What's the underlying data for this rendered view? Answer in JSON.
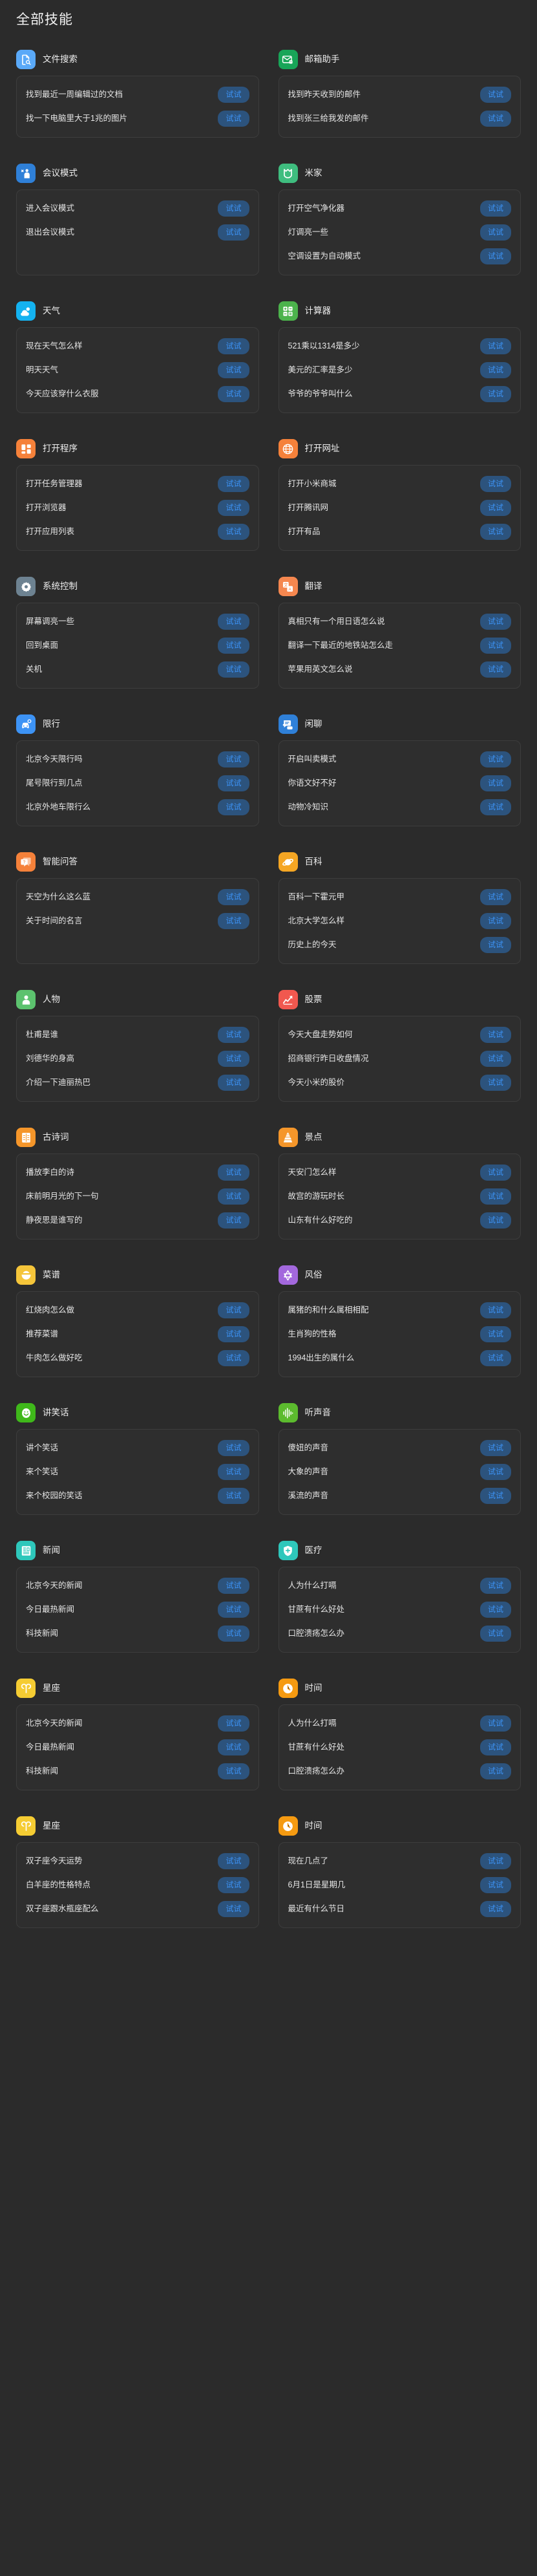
{
  "page": {
    "title": "全部技能",
    "try_label": "试试",
    "background_color": "#2b2b2b",
    "card_color": "#2e2e2e",
    "card_border_color": "#3d3d3d",
    "button_bg_color": "#2c537d",
    "button_text_color": "#3d93f5"
  },
  "sections": [
    {
      "name": "文件搜索",
      "icon": "document-search-icon",
      "icon_color": "#5aa9f8",
      "items": [
        "找到最近一周编辑过的文档",
        "找一下电脑里大于1兆的图片"
      ]
    },
    {
      "name": "邮箱助手",
      "icon": "envelope-icon",
      "icon_color": "#18a558",
      "items": [
        "找到昨天收到的邮件",
        "找到张三给我发的邮件"
      ]
    },
    {
      "name": "会议模式",
      "icon": "person-presenting-icon",
      "icon_color": "#2f80d8",
      "items": [
        "进入会议模式",
        "退出会议模式"
      ]
    },
    {
      "name": "米家",
      "icon": "mijia-logo-icon",
      "icon_color": "#3fbd7f",
      "items": [
        "打开空气净化器",
        "灯调亮一些",
        "空调设置为自动模式"
      ]
    },
    {
      "name": "天气",
      "icon": "sun-cloud-icon",
      "icon_color": "#14b2f0",
      "items": [
        "现在天气怎么样",
        "明天天气",
        "今天应该穿什么衣服"
      ]
    },
    {
      "name": "计算器",
      "icon": "calculator-icon",
      "icon_color": "#4cb34c",
      "items": [
        "521乘以1314是多少",
        "美元的汇率是多少",
        "爷爷的爷爷叫什么"
      ]
    },
    {
      "name": "打开程序",
      "icon": "app-grid-icon",
      "icon_color": "#f5813a",
      "items": [
        "打开任务管理器",
        "打开浏览器",
        "打开应用列表"
      ]
    },
    {
      "name": "打开网址",
      "icon": "globe-icon",
      "icon_color": "#f5813a",
      "items": [
        "打开小米商城",
        "打开腾讯网",
        "打开有品"
      ]
    },
    {
      "name": "系统控制",
      "icon": "gear-icon",
      "icon_color": "#6d8291",
      "items": [
        "屏幕调亮一些",
        "回到桌面",
        "关机"
      ]
    },
    {
      "name": "翻译",
      "icon": "translate-icon",
      "icon_color": "#f5874f",
      "items": [
        "真相只有一个用日语怎么说",
        "翻译一下最近的地铁站怎么走",
        "苹果用英文怎么说"
      ]
    },
    {
      "name": "限行",
      "icon": "car-restriction-icon",
      "icon_color": "#3d93f5",
      "items": [
        "北京今天限行吗",
        "尾号限行到几点",
        "北京外地车限行么"
      ]
    },
    {
      "name": "闲聊",
      "icon": "chat-bubble-icon",
      "icon_color": "#2f80d8",
      "items": [
        "开启叫卖模式",
        "你语文好不好",
        "动物冷知识"
      ]
    },
    {
      "name": "智能问答",
      "icon": "question-bubble-icon",
      "icon_color": "#f5813a",
      "items": [
        "天空为什么这么蓝",
        "关于时间的名言"
      ]
    },
    {
      "name": "百科",
      "icon": "saturn-icon",
      "icon_color": "#f5a623",
      "items": [
        "百科一下霍元甲",
        "北京大学怎么样",
        "历史上的今天"
      ]
    },
    {
      "name": "人物",
      "icon": "person-avatar-icon",
      "icon_color": "#5cc26e",
      "items": [
        "杜甫是谁",
        "刘德华的身高",
        "介绍一下迪丽热巴"
      ]
    },
    {
      "name": "股票",
      "icon": "stock-chart-icon",
      "icon_color": "#f1584f",
      "items": [
        "今天大盘走势如何",
        "招商银行昨日收盘情况",
        "今天小米的股价"
      ]
    },
    {
      "name": "古诗词",
      "icon": "poem-book-icon",
      "icon_color": "#f5962a",
      "items": [
        "播放李白的诗",
        "床前明月光的下一句",
        "静夜思是谁写的"
      ]
    },
    {
      "name": "景点",
      "icon": "pagoda-icon",
      "icon_color": "#f5962a",
      "items": [
        "天安门怎么样",
        "故宫的游玩时长",
        "山东有什么好吃的"
      ]
    },
    {
      "name": "菜谱",
      "icon": "rice-bowl-icon",
      "icon_color": "#f5c53a",
      "items": [
        "红烧肉怎么做",
        "推荐菜谱",
        "牛肉怎么做好吃"
      ]
    },
    {
      "name": "风俗",
      "icon": "star-hexagram-icon",
      "icon_color": "#a368dd",
      "items": [
        "属猪的和什么属相相配",
        "生肖狗的性格",
        "1994出生的属什么"
      ]
    },
    {
      "name": "讲笑话",
      "icon": "smiling-face-icon",
      "icon_color": "#3fb81a",
      "items": [
        "讲个笑话",
        "来个笑话",
        "来个校园的笑话"
      ]
    },
    {
      "name": "听声音",
      "icon": "sound-wave-icon",
      "icon_color": "#5cbb2e",
      "items": [
        "傻妞的声音",
        "大象的声音",
        "溪流的声音"
      ]
    },
    {
      "name": "新闻",
      "icon": "newspaper-icon",
      "icon_color": "#2ec7bb",
      "items": [
        "北京今天的新闻",
        "今日最热新闻",
        "科技新闻"
      ]
    },
    {
      "name": "医疗",
      "icon": "medical-shield-icon",
      "icon_color": "#2ec7bb",
      "items": [
        "人为什么打嗝",
        "甘蔗有什么好处",
        "口腔溃疡怎么办"
      ]
    },
    {
      "name": "星座",
      "icon": "aries-zodiac-icon",
      "icon_color": "#f5cc33",
      "items": [
        "北京今天的新闻",
        "今日最热新闻",
        "科技新闻"
      ]
    },
    {
      "name": "时间",
      "icon": "clock-icon",
      "icon_color": "#f59a11",
      "items": [
        "人为什么打嗝",
        "甘蔗有什么好处",
        "口腔溃疡怎么办"
      ]
    },
    {
      "name": "星座",
      "icon": "aries-zodiac-icon",
      "icon_color": "#f5cc33",
      "items": [
        "双子座今天运势",
        "白羊座的性格特点",
        "双子座跟水瓶座配么"
      ]
    },
    {
      "name": "时间",
      "icon": "clock-icon",
      "icon_color": "#f59a11",
      "items": [
        "现在几点了",
        "6月1日是星期几",
        "最近有什么节日"
      ]
    }
  ]
}
